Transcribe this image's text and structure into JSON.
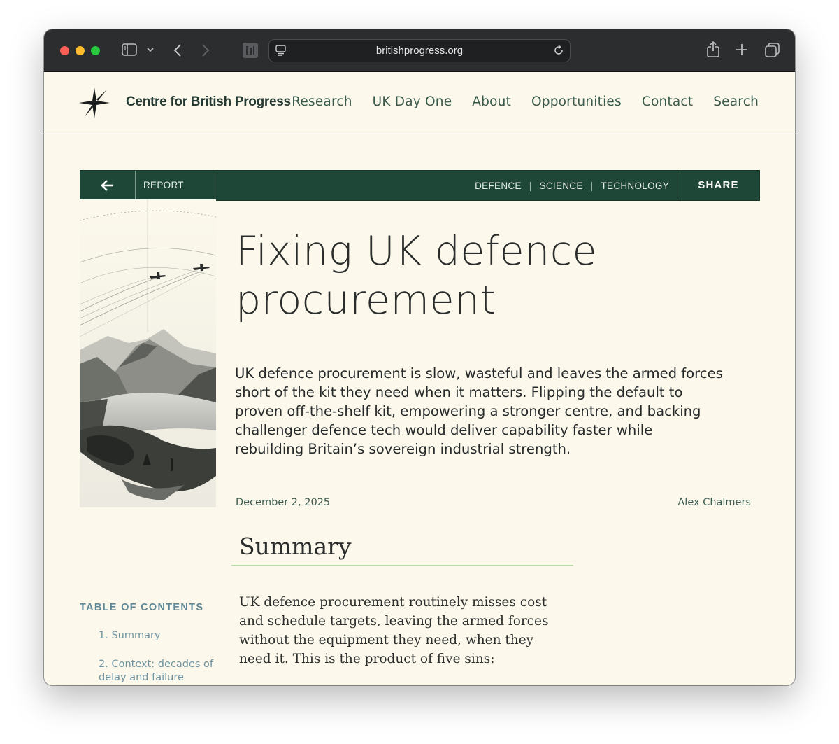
{
  "browser": {
    "url": "britishprogress.org"
  },
  "site": {
    "brand": "Centre for British Progress",
    "nav": [
      "Research",
      "UK Day One",
      "About",
      "Opportunities",
      "Contact",
      "Search"
    ]
  },
  "report_bar": {
    "type_label": "REPORT",
    "tags": [
      "DEFENCE",
      "SCIENCE",
      "TECHNOLOGY"
    ],
    "share_label": "SHARE"
  },
  "article": {
    "title_line1": "Fixing UK defence",
    "title_line2": "procurement",
    "lede": "UK defence procurement is slow, wasteful and leaves the armed forces short of the kit they need when it matters. Flipping the default to proven off-the-shelf kit, empowering a stronger centre, and backing challenger defence tech would deliver capability faster while rebuilding Britain’s sovereign industrial strength.",
    "date": "December 2, 2025",
    "author": "Alex Chalmers",
    "summary_heading": "Summary",
    "summary_text": "UK defence procurement routinely misses cost and schedule targets, leaving the armed forces without the equipment they need, when they need it. This is the product of five sins:"
  },
  "toc": {
    "title": "TABLE OF CONTENTS",
    "items": [
      "1. Summary",
      "2. Context: decades of delay and failure"
    ]
  }
}
